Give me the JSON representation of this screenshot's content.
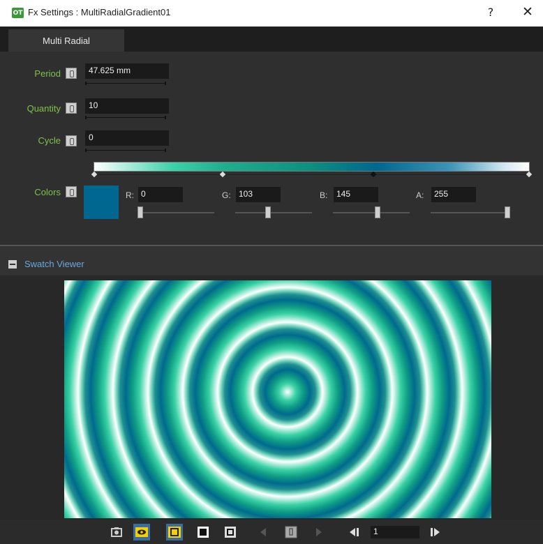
{
  "window": {
    "icon_text": "OT",
    "title": "Fx Settings : MultiRadialGradient01",
    "help_label": "?",
    "close_label": "✕"
  },
  "tabs": [
    {
      "label": "Multi Radial"
    }
  ],
  "settings": {
    "period": {
      "label": "Period",
      "value": "47.625 mm"
    },
    "quantity": {
      "label": "Quantity",
      "value": "10"
    },
    "cycle": {
      "label": "Cycle",
      "value": "0"
    },
    "colors": {
      "label": "Colors",
      "swatch_color": "#006791",
      "channels": [
        {
          "label": "R:",
          "value": "0",
          "level": 0.0
        },
        {
          "label": "G:",
          "value": "103",
          "level": 0.404
        },
        {
          "label": "B:",
          "value": "145",
          "level": 0.569
        },
        {
          "label": "A:",
          "value": "255",
          "level": 1.0
        }
      ]
    }
  },
  "swatch_viewer": {
    "title": "Swatch Viewer",
    "frame_value": "1"
  },
  "toolbar": {
    "buttons": [
      "camera-icon",
      "eye-icon",
      "square-outline-icon",
      "square-filled-icon",
      "checker-icon",
      "prev-icon",
      "key-icon",
      "next-icon",
      "first-frame-icon",
      "last-frame-icon"
    ]
  },
  "colors": {
    "accent_label": "#7fc24a",
    "panel_title": "#6aa8e0",
    "highlight": "#f5d000"
  }
}
